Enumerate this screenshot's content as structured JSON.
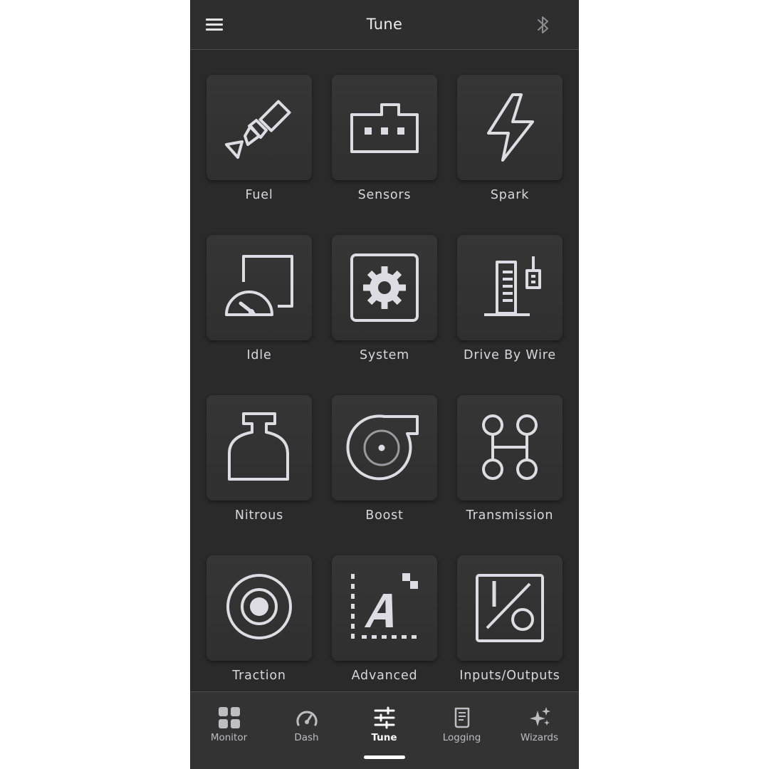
{
  "header": {
    "title": "Tune",
    "menu_icon": "hamburger-menu-icon",
    "status_icon": "bluetooth-icon"
  },
  "tiles": [
    {
      "label": "Fuel",
      "icon": "fuel-injector-icon"
    },
    {
      "label": "Sensors",
      "icon": "sensor-connector-icon"
    },
    {
      "label": "Spark",
      "icon": "lightning-bolt-icon"
    },
    {
      "label": "Idle",
      "icon": "idle-gauge-icon"
    },
    {
      "label": "System",
      "icon": "gear-box-icon"
    },
    {
      "label": "Drive By Wire",
      "icon": "throttle-pedal-icon"
    },
    {
      "label": "Nitrous",
      "icon": "nitrous-bottle-icon"
    },
    {
      "label": "Boost",
      "icon": "turbo-icon"
    },
    {
      "label": "Transmission",
      "icon": "shift-pattern-icon"
    },
    {
      "label": "Traction",
      "icon": "target-icon"
    },
    {
      "label": "Advanced",
      "icon": "advanced-chart-icon"
    },
    {
      "label": "Inputs/Outputs",
      "icon": "io-toggle-icon"
    }
  ],
  "bottom_nav": [
    {
      "label": "Monitor",
      "icon": "grid-icon"
    },
    {
      "label": "Dash",
      "icon": "speedometer-icon"
    },
    {
      "label": "Tune",
      "icon": "sliders-icon",
      "active": true
    },
    {
      "label": "Logging",
      "icon": "log-document-icon"
    },
    {
      "label": "Wizards",
      "icon": "sparkles-icon"
    }
  ],
  "colors": {
    "background": "#2a2a2a",
    "card": "#333333",
    "icon_stroke": "#dcdce2",
    "active_text": "#ffffff"
  }
}
